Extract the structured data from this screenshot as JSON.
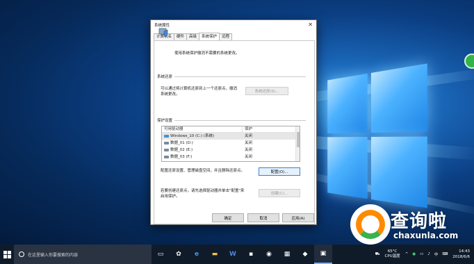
{
  "dialog": {
    "title": "系统属性",
    "tabs": [
      {
        "label": "计算机名"
      },
      {
        "label": "硬件"
      },
      {
        "label": "高级"
      },
      {
        "label": "系统保护"
      },
      {
        "label": "远程"
      }
    ],
    "active_tab": "系统保护",
    "top_description": "使用系统保护撤消不需要的系统更改。",
    "restore": {
      "group_title": "系统还原",
      "description_line1": "可以通过将计算机还原到上一个还原点，撤消",
      "description_line2": "系统更改。",
      "button": "系统还原(S)..."
    },
    "protection": {
      "group_title": "保护设置",
      "columns": [
        "可用驱动器",
        "保护"
      ],
      "rows": [
        {
          "drive": "Windows_10 (C:) (系统)",
          "status": "关闭"
        },
        {
          "drive": "数据_01 (D:)",
          "status": "关闭"
        },
        {
          "drive": "数据_02 (E:)",
          "status": "关闭"
        },
        {
          "drive": "数据_03 (F:)",
          "status": "关闭"
        }
      ],
      "configure_text": "配置还原设置、管理磁盘空间，并且删除还原点。",
      "configure_button": "配置(O)...",
      "create_text_line1": "若要创建还原点，请先选择驱动器并单击\"配置\"来",
      "create_text_line2": "启用保护。",
      "create_button": "创建(C)..."
    },
    "footer": {
      "ok": "确定",
      "cancel": "取消",
      "apply": "应用(A)"
    }
  },
  "taskbar": {
    "search_placeholder": "在这里输入你要搜索的内容",
    "cpu_temp": "65°C",
    "cpu_label": "CPU温度",
    "ime": "中",
    "time": "14:43",
    "date": "2018/6/6"
  },
  "watermark": {
    "chinese": "查询啦",
    "url": "chaxunla.com"
  },
  "colors": {
    "desktop_dark": "#062a5a",
    "desktop_light": "#3ea0e8",
    "taskbar": "#101b2a",
    "accent": "#3c7fd6"
  }
}
